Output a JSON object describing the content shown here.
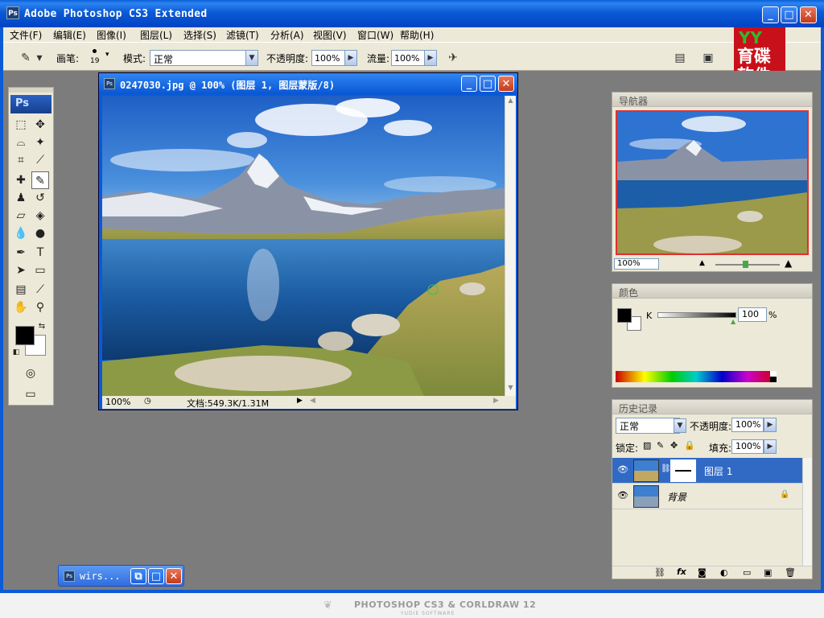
{
  "window": {
    "title": "Adobe Photoshop CS3 Extended",
    "ps_badge": "Ps",
    "min_glyph": "_",
    "max_glyph": "□",
    "close_glyph": "✕"
  },
  "menu": [
    "文件(F)",
    "编辑(E)",
    "图像(I)",
    "图层(L)",
    "选择(S)",
    "滤镜(T)",
    "分析(A)",
    "视图(V)",
    "窗口(W)",
    "帮助(H)"
  ],
  "options": {
    "brush_label": "画笔:",
    "brush_size": "19",
    "mode_label": "模式:",
    "mode_value": "正常",
    "opacity_label": "不透明度:",
    "opacity_value": "100%",
    "flow_label": "流量:",
    "flow_value": "100%"
  },
  "logo": {
    "top": "YY",
    "line1": "育碟",
    "line2": "软件"
  },
  "toolbox": {
    "logo": "Ps"
  },
  "document": {
    "title": "0247030.jpg @ 100% (图层 1, 图层蒙版/8)",
    "zoom": "100%",
    "doc_info": "文档:549.3K/1.31M"
  },
  "navigator": {
    "title": "导航器",
    "zoom": "100%"
  },
  "color": {
    "title": "颜色",
    "channel": "K",
    "value": "100",
    "unit": "%"
  },
  "layers": {
    "tab": "历史记录",
    "blend_mode": "正常",
    "opacity_label": "不透明度:",
    "opacity_value": "100%",
    "lock_label": "锁定:",
    "fill_label": "填充:",
    "fill_value": "100%",
    "items": [
      {
        "name": "图层 1",
        "selected": true
      },
      {
        "name": "背景",
        "selected": false
      }
    ]
  },
  "minimized_window": {
    "title": "wirs..."
  },
  "footer": {
    "brand": "PHOTOSHOP CS3 & CORLDRAW 12",
    "sub": "YUDIE SOFTWARE"
  }
}
